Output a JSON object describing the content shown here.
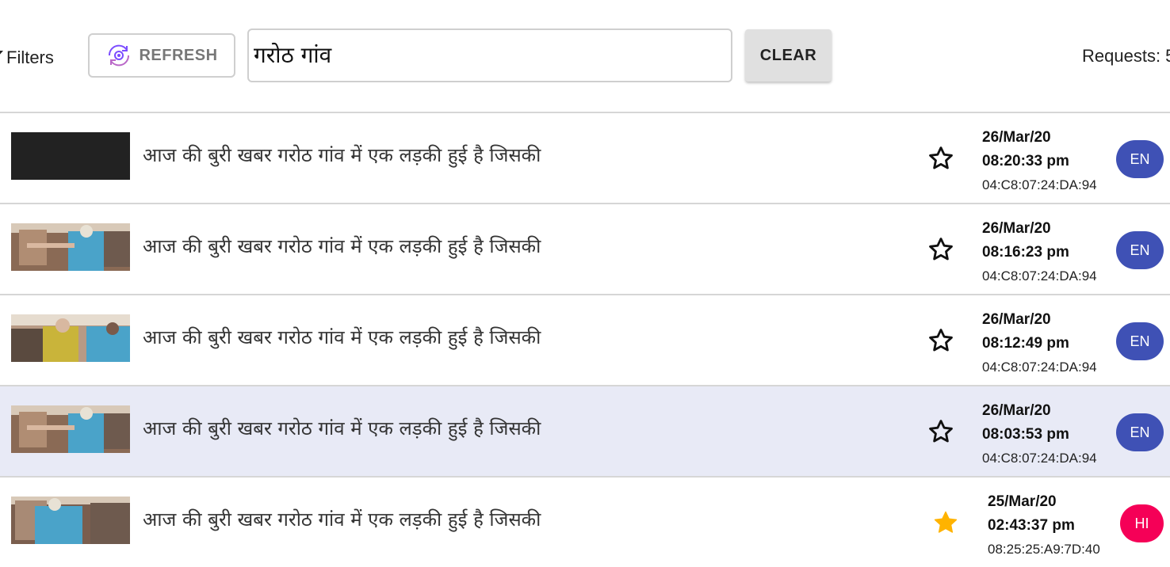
{
  "toolbar": {
    "filters_label": "Filters",
    "refresh_label": "REFRESH",
    "search_value": "गरोठ गांव",
    "clear_label": "CLEAR",
    "requests_label": "Requests: 5"
  },
  "colors": {
    "badge_en": "#3f51b5",
    "badge_hi": "#f50057",
    "star_filled": "#ffb300",
    "selected_row": "#e8eaf6"
  },
  "rows": [
    {
      "title": "आज की बुरी खबर गरोठ गांव में एक लड़की हुई है जिसकी",
      "date": "26/Mar/20",
      "time": "08:20:33 pm",
      "mac": "04:C8:07:24:DA:94",
      "lang": "EN",
      "starred": false,
      "thumbnail": "dark-placeholder"
    },
    {
      "title": "आज की बुरी खबर गरोठ गांव में एक लड़की हुई है जिसकी",
      "date": "26/Mar/20",
      "time": "08:16:23 pm",
      "mac": "04:C8:07:24:DA:94",
      "lang": "EN",
      "starred": false,
      "thumbnail": "video-frame"
    },
    {
      "title": "आज की बुरी खबर गरोठ गांव में एक लड़की हुई है जिसकी",
      "date": "26/Mar/20",
      "time": "08:12:49 pm",
      "mac": "04:C8:07:24:DA:94",
      "lang": "EN",
      "starred": false,
      "thumbnail": "video-frame"
    },
    {
      "title": "आज की बुरी खबर गरोठ गांव में एक लड़की हुई है जिसकी",
      "date": "26/Mar/20",
      "time": "08:03:53 pm",
      "mac": "04:C8:07:24:DA:94",
      "lang": "EN",
      "starred": false,
      "thumbnail": "video-frame",
      "selected": true
    },
    {
      "title": "आज की बुरी खबर गरोठ गांव में एक लड़की हुई है जिसकी",
      "date": "25/Mar/20",
      "time": "02:43:37 pm",
      "mac": "08:25:25:A9:7D:40",
      "lang": "HI",
      "starred": true,
      "thumbnail": "video-frame"
    }
  ]
}
